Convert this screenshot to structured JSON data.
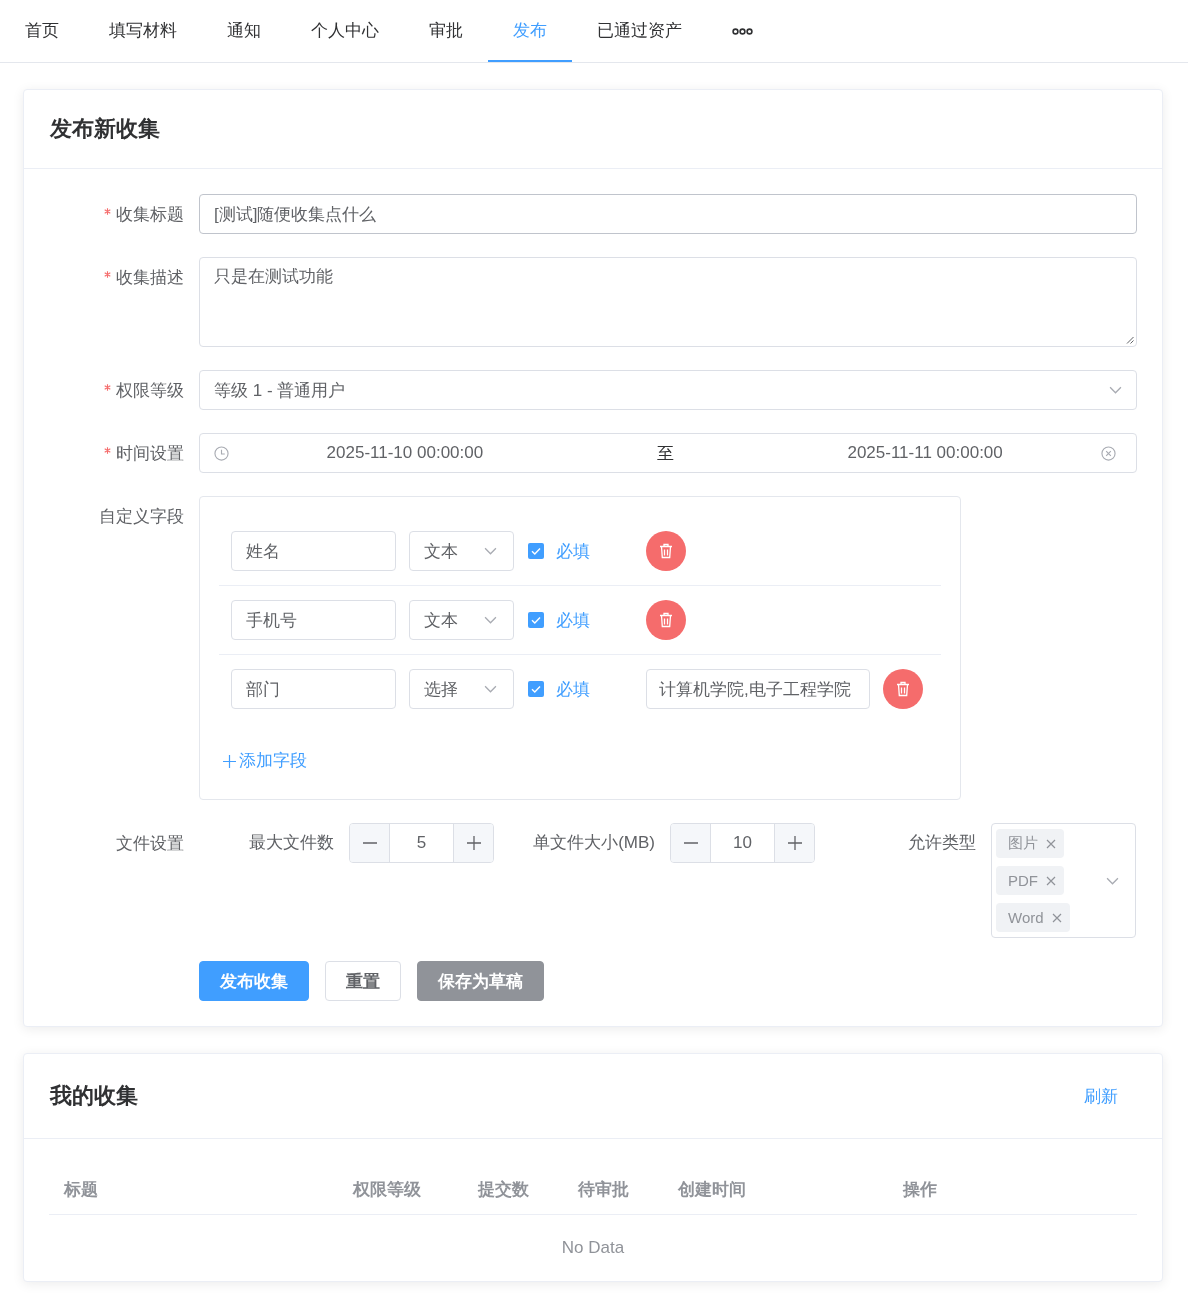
{
  "nav": {
    "tabs": [
      {
        "label": "首页",
        "selected": false
      },
      {
        "label": "填写材料",
        "selected": false
      },
      {
        "label": "通知",
        "selected": false
      },
      {
        "label": "个人中心",
        "selected": false
      },
      {
        "label": "审批",
        "selected": false
      },
      {
        "label": "发布",
        "selected": true
      },
      {
        "label": "已通过资产",
        "selected": false
      }
    ]
  },
  "publish_form": {
    "title": "发布新收集",
    "fields": [
      {
        "kind": "input",
        "label": "收集标题",
        "required": true,
        "value": "[测试]随便收集点什么"
      },
      {
        "kind": "textarea",
        "label": "收集描述",
        "required": true,
        "value": "只是在测试功能"
      },
      {
        "kind": "select",
        "label": "权限等级",
        "required": true,
        "value": "等级 1 - 普通用户"
      },
      {
        "kind": "daterange",
        "label": "时间设置",
        "required": true,
        "start": "2025-11-10 00:00:00",
        "separator": "至",
        "end": "2025-11-11 00:00:00"
      }
    ],
    "custom_fields": {
      "label": "自定义字段",
      "rows": [
        {
          "name": "姓名",
          "type": "文本",
          "checked": true,
          "check_label": "必填"
        },
        {
          "name": "手机号",
          "type": "文本",
          "checked": true,
          "check_label": "必填"
        },
        {
          "name": "部门",
          "type": "选择",
          "checked": true,
          "check_label": "必填",
          "options": "计算机学院,电子工程学院"
        }
      ],
      "add_label": "添加字段"
    },
    "file_settings": {
      "label": "文件设置",
      "max_files": {
        "label": "最大文件数",
        "value": "5"
      },
      "max_size": {
        "label": "单文件大小(MB)",
        "value": "10"
      },
      "allowed_types": {
        "label": "允许类型",
        "tags": [
          "图片",
          "PDF",
          "Word"
        ]
      }
    },
    "buttons": [
      {
        "kind": "primary",
        "label": "发布收集"
      },
      {
        "kind": "default",
        "label": "重置"
      },
      {
        "kind": "info",
        "label": "保存为草稿"
      }
    ]
  },
  "my_collections": {
    "title": "我的收集",
    "refresh": "刷新",
    "table": {
      "columns": [
        "标题",
        "权限等级",
        "提交数",
        "待审批",
        "创建时间",
        "操作"
      ],
      "empty_text": "No Data"
    }
  }
}
